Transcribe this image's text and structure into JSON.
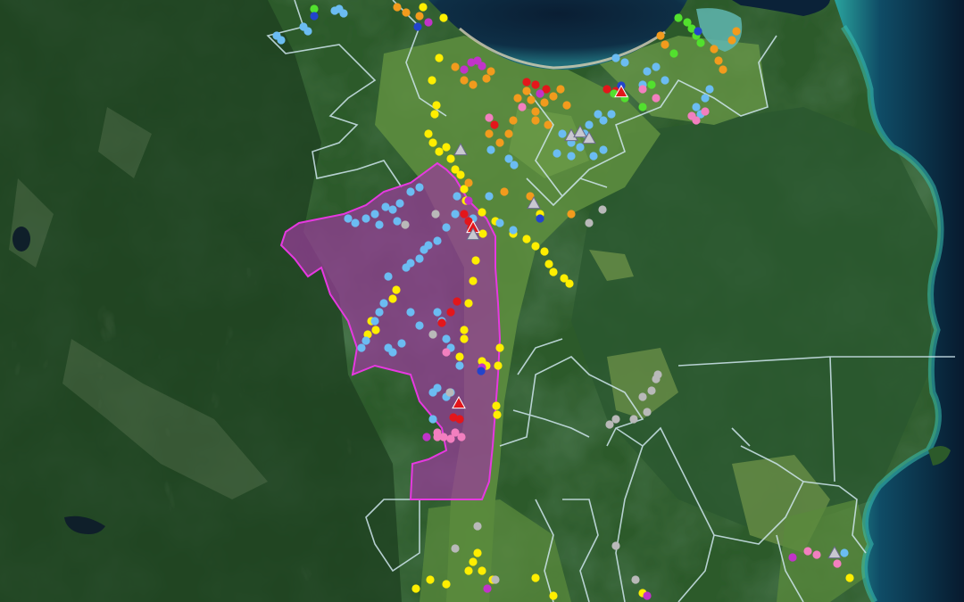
{
  "map": {
    "view": "satellite",
    "features": [
      "sea-bay-north",
      "sea-east-coast",
      "valley-farmland",
      "boundary-lines",
      "highlighted-region",
      "point-markers",
      "triangle-markers"
    ]
  },
  "colors": {
    "forest_dark": "#18321c",
    "forest": "#2c5a2a",
    "farmland": "#5f8f3f",
    "sea_deep": "#0b2238",
    "sea_shallow": "#2fa6a0",
    "beach": "#d9d2b4",
    "boundary": "#cfe6ee",
    "region_fill": "#9a3b9b",
    "region_stroke": "#e639e0",
    "marker_yellow": "#ffee00",
    "marker_blue": "#6bbcf2",
    "marker_orange": "#f29b1d",
    "marker_red": "#e3161b",
    "marker_pink": "#f27fbf",
    "marker_magenta": "#c133c9",
    "marker_green": "#52e02e",
    "marker_grey": "#b9b9b9",
    "marker_navy": "#2244cc"
  },
  "marker_types": [
    {
      "shape": "circle",
      "color": "yellow"
    },
    {
      "shape": "circle",
      "color": "light-blue"
    },
    {
      "shape": "circle",
      "color": "orange"
    },
    {
      "shape": "circle",
      "color": "red"
    },
    {
      "shape": "circle",
      "color": "pink"
    },
    {
      "shape": "circle",
      "color": "magenta"
    },
    {
      "shape": "circle",
      "color": "green"
    },
    {
      "shape": "circle",
      "color": "grey"
    },
    {
      "shape": "triangle",
      "color": "red"
    },
    {
      "shape": "triangle",
      "color": "grey"
    }
  ]
}
